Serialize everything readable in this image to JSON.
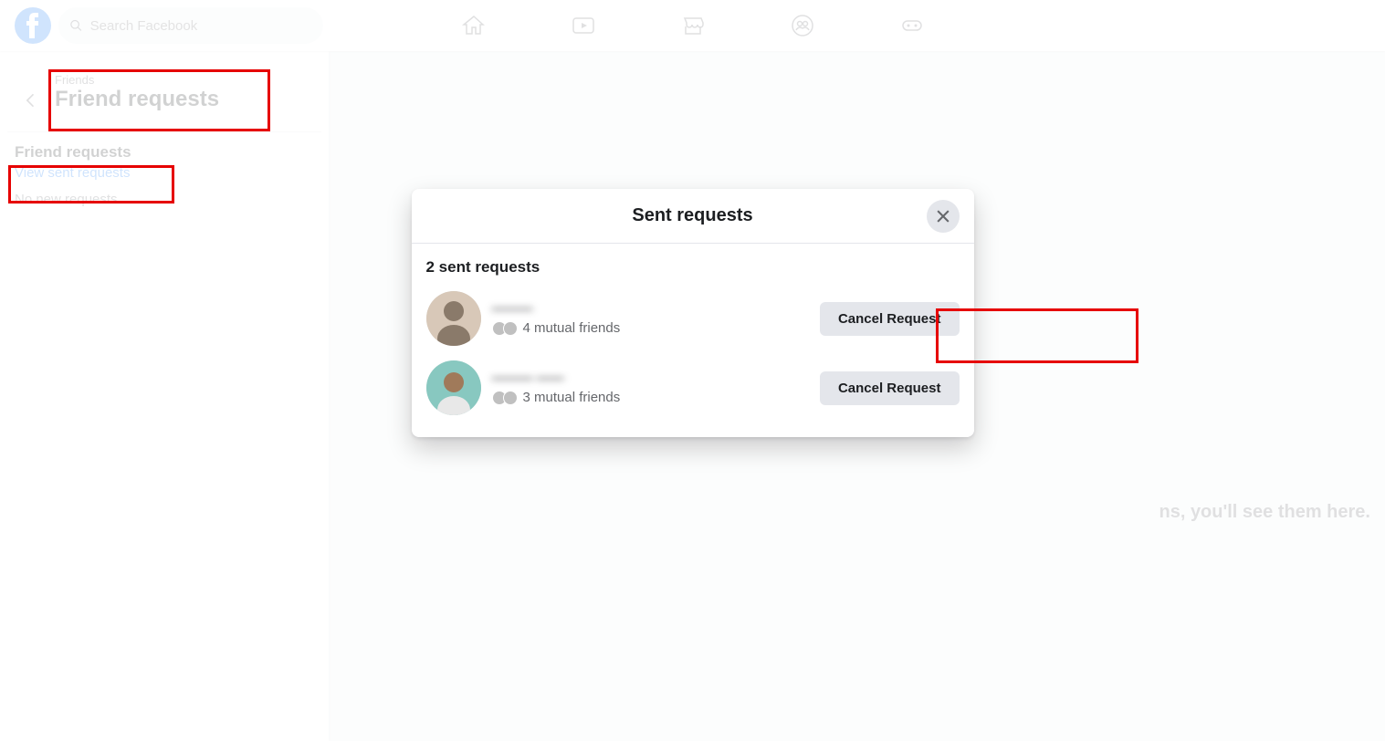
{
  "search": {
    "placeholder": "Search Facebook"
  },
  "sidebar": {
    "breadcrumb": "Friends",
    "title": "Friend requests",
    "section_title": "Friend requests",
    "view_sent_link": "View sent requests",
    "no_requests": "No new requests"
  },
  "bg_hint": "ns, you'll see them here.",
  "modal": {
    "title": "Sent requests",
    "count_label": "2 sent requests",
    "requests": [
      {
        "name": "———",
        "mutual": "4 mutual friends",
        "cancel": "Cancel Request"
      },
      {
        "name": "——— ——",
        "mutual": "3 mutual friends",
        "cancel": "Cancel Request"
      }
    ]
  },
  "colors": {
    "accent": "#1877f2",
    "highlight": "#e60000"
  }
}
